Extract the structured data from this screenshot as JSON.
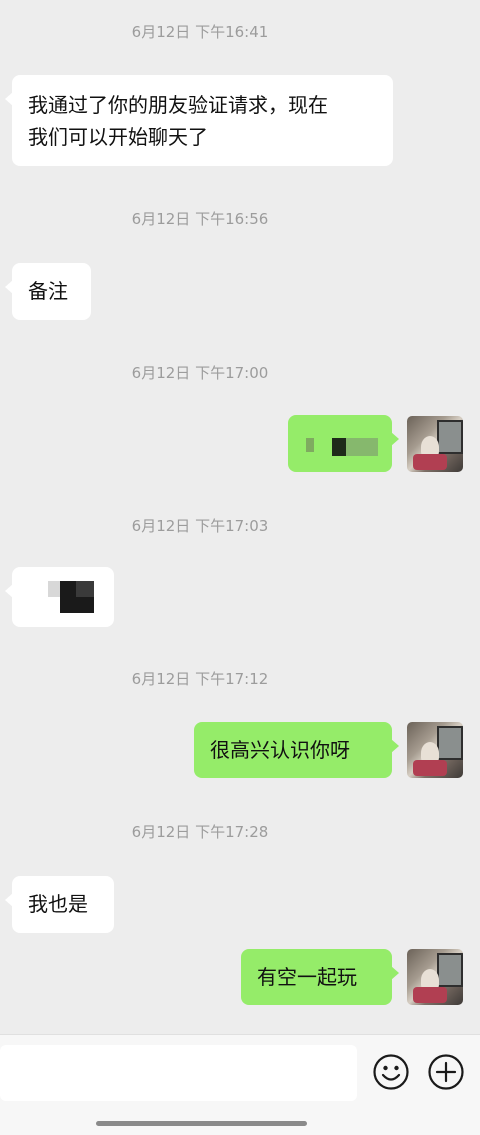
{
  "messages": [
    {
      "type": "timestamp",
      "text": "6月12日 下午16:41"
    },
    {
      "type": "text",
      "side": "left",
      "lines": [
        "我通过了你的朋友验证请求，现在",
        "我们可以开始聊天了"
      ]
    },
    {
      "type": "timestamp",
      "text": "6月12日 下午16:56"
    },
    {
      "type": "text",
      "side": "left",
      "text": "备注"
    },
    {
      "type": "timestamp",
      "text": "6月12日 下午17:00"
    },
    {
      "type": "pixelated",
      "side": "right"
    },
    {
      "type": "timestamp",
      "text": "6月12日 下午17:03"
    },
    {
      "type": "pixelated",
      "side": "left"
    },
    {
      "type": "timestamp",
      "text": "6月12日 下午17:12"
    },
    {
      "type": "text",
      "side": "right",
      "text": "很高兴认识你呀"
    },
    {
      "type": "timestamp",
      "text": "6月12日 下午17:28"
    },
    {
      "type": "text",
      "side": "left",
      "text": "我也是"
    },
    {
      "type": "text",
      "side": "right",
      "text": "有空一起玩"
    }
  ],
  "input_bar": {
    "emoji_icon": "emoji-icon",
    "plus_icon": "plus-icon"
  },
  "colors": {
    "background": "#ededed",
    "outgoing_bubble": "#95ec69",
    "incoming_bubble": "#ffffff",
    "timestamp_text": "#9c9c9c"
  }
}
